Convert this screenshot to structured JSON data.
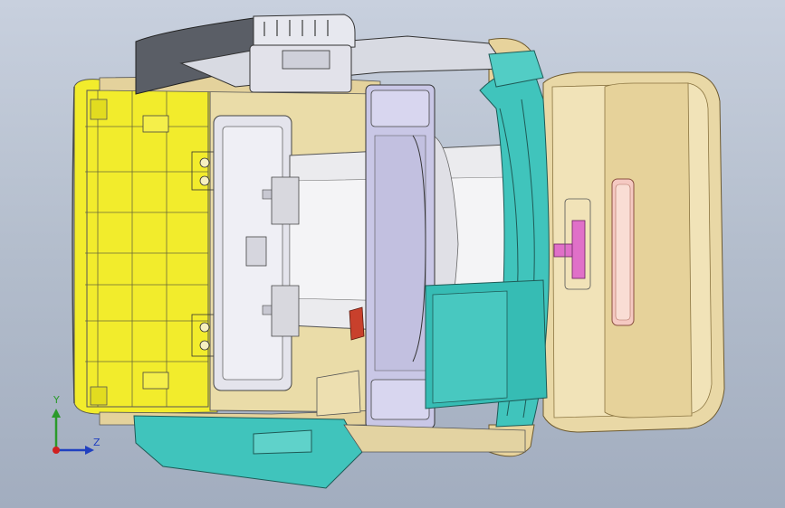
{
  "viewport": {
    "name": "cad-3d-viewport",
    "background_top": "#c8d0de",
    "background_bottom": "#a2adbf"
  },
  "model": {
    "parts": [
      "yellow-housing",
      "beige-cover",
      "teal-bracket",
      "gray-cover",
      "lavender-pillar",
      "pink-clip"
    ],
    "colors": {
      "yellow": "#f2ec2c",
      "beige": "#e9d8a6",
      "teal": "#40c4bc",
      "dark_gray": "#5a5e66",
      "light_gray": "#e3e4ec",
      "lavender": "#c9c7e6",
      "pink": "#e070c8"
    }
  },
  "triad": {
    "y_label": "Y",
    "z_label": "Z",
    "y_color": "#2a9a2a",
    "z_color": "#2040c0",
    "x_color": "#d02020"
  }
}
